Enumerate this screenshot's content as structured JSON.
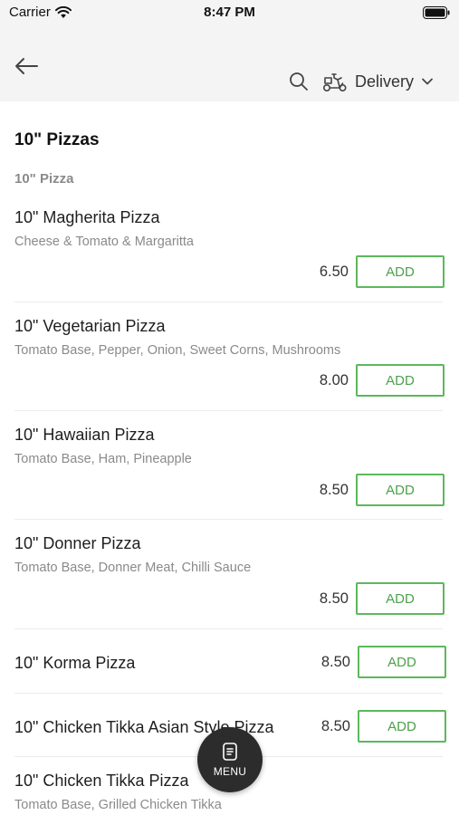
{
  "status_bar": {
    "carrier": "Carrier",
    "time": "8:47 PM"
  },
  "nav": {
    "delivery_label": "Delivery"
  },
  "section": {
    "title": "10\" Pizzas",
    "category": "10\" Pizza"
  },
  "items": [
    {
      "name": "10\" Magherita Pizza",
      "desc": "Cheese & Tomato & Margaritta",
      "price": "6.50",
      "add": "ADD"
    },
    {
      "name": "10\" Vegetarian Pizza",
      "desc": "Tomato Base, Pepper, Onion, Sweet Corns, Mushrooms",
      "price": "8.00",
      "add": "ADD"
    },
    {
      "name": "10\" Hawaiian Pizza",
      "desc": "Tomato Base, Ham, Pineapple",
      "price": "8.50",
      "add": "ADD"
    },
    {
      "name": "10\" Donner Pizza",
      "desc": "Tomato Base, Donner Meat, Chilli Sauce",
      "price": "8.50",
      "add": "ADD"
    },
    {
      "name": "10\" Korma Pizza",
      "desc": "",
      "price": "8.50",
      "add": "ADD"
    },
    {
      "name": "10\" Chicken Tikka Asian Style Pizza",
      "desc": "",
      "price": "8.50",
      "add": "ADD"
    },
    {
      "name": "10\" Chicken Tikka Pizza",
      "desc": "Tomato Base, Grilled Chicken Tikka",
      "price": "",
      "add": ""
    }
  ],
  "fab": {
    "label": "MENU"
  },
  "colors": {
    "accent": "#5cb85c",
    "header_bg": "#f4f4f4",
    "fab_bg": "#2c2c2c"
  }
}
